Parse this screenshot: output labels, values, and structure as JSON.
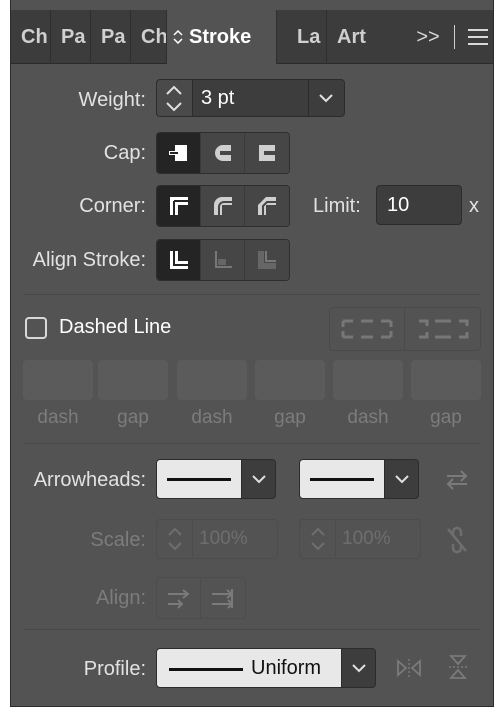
{
  "tabs": [
    {
      "label": "Ch"
    },
    {
      "label": "Pa"
    },
    {
      "label": "Pa"
    },
    {
      "label": "Ch"
    },
    {
      "label": "Stroke",
      "chevron": "⌃⌄"
    },
    {
      "label": "La"
    },
    {
      "label": "Art"
    }
  ],
  "tab_tools": {
    "more": ">>"
  },
  "weight": {
    "label": "Weight:",
    "value": "3 pt"
  },
  "cap": {
    "label": "Cap:"
  },
  "corner": {
    "label": "Corner:",
    "limit_label": "Limit:",
    "limit_value": "10",
    "limit_unit": "x"
  },
  "align_stroke": {
    "label": "Align Stroke:"
  },
  "dashed": {
    "label": "Dashed Line",
    "checked": false
  },
  "dash_fields": [
    "dash",
    "gap",
    "dash",
    "gap",
    "dash",
    "gap"
  ],
  "arrowheads": {
    "label": "Arrowheads:"
  },
  "scale": {
    "label": "Scale:",
    "start": "100%",
    "end": "100%"
  },
  "align": {
    "label": "Align:"
  },
  "profile": {
    "label": "Profile:",
    "value": "Uniform"
  },
  "colors": {
    "panel": "#535353",
    "tabbar": "#3c3c3c",
    "selected_button": "#242424",
    "swatch": "#e8e8e8"
  }
}
